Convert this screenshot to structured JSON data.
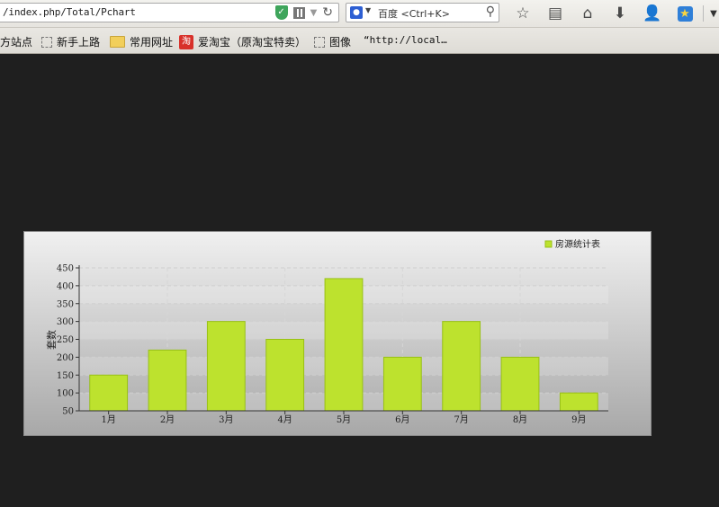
{
  "browser": {
    "url": "/index.php/Total/Pchart",
    "search_placeholder": "百度 <Ctrl+K>",
    "search_engine_icon": "baidu-paw-icon"
  },
  "bookmarks": [
    {
      "label": "方站点",
      "icon": "none"
    },
    {
      "label": "新手上路",
      "icon": "page-icon"
    },
    {
      "label": "常用网址",
      "icon": "folder-icon"
    },
    {
      "label": "爱淘宝（原淘宝特卖）",
      "icon": "taobao-icon"
    },
    {
      "label": "图像",
      "icon": "page-icon"
    },
    {
      "label": "“http://local…",
      "icon": "none"
    }
  ],
  "toolbar_icons": [
    "bookmark-star-icon",
    "reading-list-icon",
    "home-icon",
    "download-icon",
    "account-icon",
    "favorites-icon",
    "menu-dropdown-icon"
  ],
  "colors": {
    "bar_fill": "#bde22e",
    "bar_stroke": "#98c016",
    "page_bg": "#1f1f1f"
  },
  "chart_data": {
    "type": "bar",
    "categories": [
      "1月",
      "2月",
      "3月",
      "4月",
      "5月",
      "6月",
      "7月",
      "8月",
      "9月"
    ],
    "series": [
      {
        "name": "房源统计表",
        "values": [
          150,
          220,
          300,
          250,
          420,
          200,
          300,
          200,
          100
        ]
      }
    ],
    "ylabel": "套数",
    "xlabel": "",
    "ylim": [
      50,
      450
    ],
    "yticks": [
      50,
      100,
      150,
      200,
      250,
      300,
      350,
      400,
      450
    ],
    "grid": true,
    "legend": "top-right"
  }
}
